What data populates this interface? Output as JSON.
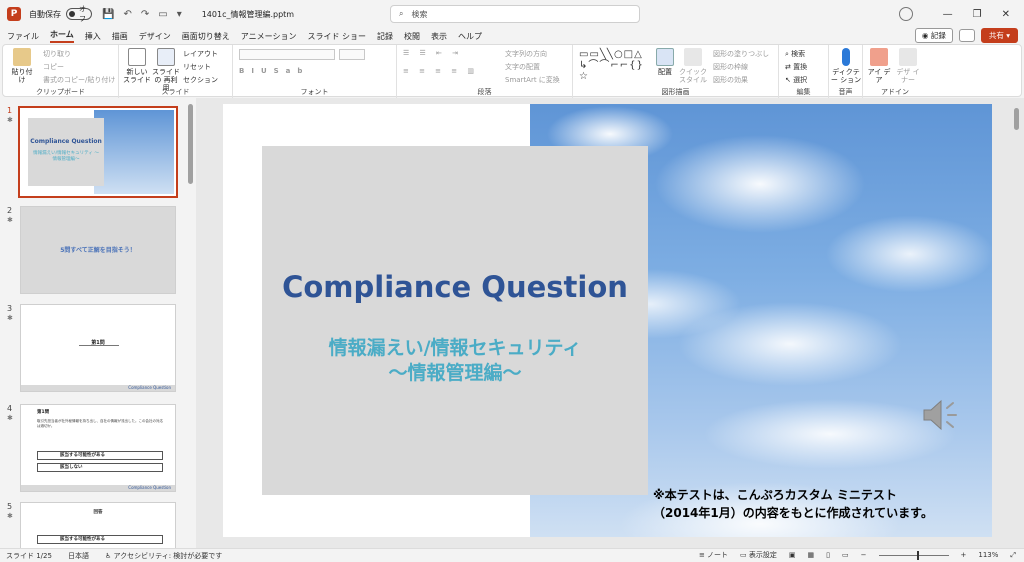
{
  "titlebar": {
    "autosave_label": "自動保存",
    "autosave_state": "オフ",
    "filename": "1401c_情報管理編.pptm",
    "search_placeholder": "検索"
  },
  "tabs": [
    "ファイル",
    "ホーム",
    "挿入",
    "描画",
    "デザイン",
    "画面切り替え",
    "アニメーション",
    "スライド ショー",
    "記録",
    "校閲",
    "表示",
    "ヘルプ"
  ],
  "active_tab": "ホーム",
  "record_button": "記録",
  "share_button": "共有",
  "ribbon": {
    "clipboard": {
      "paste": "貼り付け",
      "cut": "切り取り",
      "copy": "コピー",
      "format_painter": "書式のコピー/貼り付け",
      "label": "クリップボード"
    },
    "slides": {
      "new_slide": "新しい スライド",
      "reuse": "スライドの 再利用",
      "layout": "レイアウト",
      "reset": "リセット",
      "section": "セクション",
      "label": "スライド"
    },
    "font": {
      "label": "フォント"
    },
    "paragraph": {
      "text_direction": "文字列の方向",
      "align_text": "文字の配置",
      "smartart": "SmartArt に変換",
      "label": "段落"
    },
    "drawing": {
      "arrange": "配置",
      "quick_styles": "クイック スタイル",
      "fill": "図形の塗りつぶし",
      "outline": "図形の枠線",
      "effects": "図形の効果",
      "label": "図形描画"
    },
    "editing": {
      "find": "検索",
      "replace": "置換",
      "select": "選択",
      "label": "編集"
    },
    "voice": {
      "dictate": "ディクテー ション",
      "label": "音声"
    },
    "designer": {
      "ideas": "アイ デア",
      "designer": "デザ イナー",
      "label": "デザイナー"
    },
    "designer_group_label": "アドイン"
  },
  "thumbnails": [
    {
      "num": "1",
      "title": "Compliance Question",
      "subtitle": "情報漏えい/情報セキュリティ ～情報管理編～"
    },
    {
      "num": "2",
      "text": "5問すべて正解を目指そう！"
    },
    {
      "num": "3",
      "text": "第1問",
      "footer": "Compliance Question"
    },
    {
      "num": "4",
      "header": "第1問",
      "body": "取引先担当者が社外秘情報を持ち出し、自社の情報が流出した。この会社の対応は適切か。",
      "opt1": "該当する可能性がある",
      "opt2": "該当しない",
      "footer": "Compliance Question"
    },
    {
      "num": "5",
      "header": "回答",
      "opt1": "該当する可能性がある"
    }
  ],
  "slide": {
    "title": "Compliance Question",
    "subtitle_line1": "情報漏えい/情報セキュリティ",
    "subtitle_line2": "～情報管理編～",
    "note_line1": "※本テストは、こんぷろカスタム ミニテスト",
    "note_line2": "（2014年1月）の内容をもとに作成されています。"
  },
  "statusbar": {
    "slide_count": "スライド 1/25",
    "language": "日本語",
    "accessibility": "アクセシビリティ: 検討が必要です",
    "notes": "ノート",
    "display_settings": "表示設定",
    "zoom": "113%"
  },
  "colors": {
    "accent": "#c43e1c",
    "title_blue": "#2f5496",
    "subtitle_teal": "#4bacc6",
    "box_gray": "#d9d9d9"
  }
}
